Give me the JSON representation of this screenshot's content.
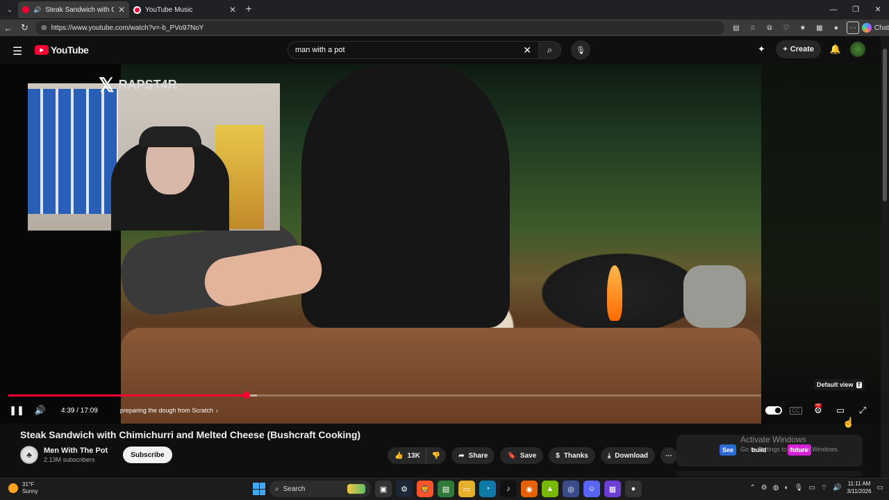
{
  "browser": {
    "tabs": [
      {
        "label": "Steak Sandwich with Chimichurri",
        "active": true
      },
      {
        "label": "YouTube Music",
        "active": false
      }
    ],
    "url": "https://www.youtube.com/watch?v=-b_PVo97NoY",
    "chat_label": "Chat"
  },
  "header": {
    "logo_text": "YouTube",
    "search_value": "man with a pot",
    "create_label": "Create"
  },
  "player": {
    "stream_tag": "RAPST4R",
    "tooltip": "Default view",
    "tooltip_key": "T",
    "time": "4:39 / 17:09",
    "chapter": "preparing the dough from Scratch",
    "played_fraction": 0.316,
    "loaded_fraction": 0.33
  },
  "video": {
    "title": "Steak Sandwich with Chimichurri and Melted Cheese (Bushcraft Cooking)",
    "channel_name": "Men With The Pot",
    "subscribers": "2.13M subscribers",
    "subscribe_label": "Subscribe",
    "actions": {
      "likes": "13K",
      "share": "Share",
      "save": "Save",
      "thanks": "Thanks",
      "download": "Download"
    }
  },
  "side_card": {
    "chip_see": "See",
    "chip_build": "build",
    "chip_future": "future"
  },
  "watermark": {
    "line1": "Activate Windows",
    "line2": "Go to Settings to activate Windows."
  },
  "taskbar": {
    "temp": "31°F",
    "condition": "Sunny",
    "search_placeholder": "Search",
    "time": "11:11 AM",
    "date": "3/11/2026"
  },
  "colors": {
    "accent": "#ff0033",
    "background": "#0f0f0f"
  }
}
